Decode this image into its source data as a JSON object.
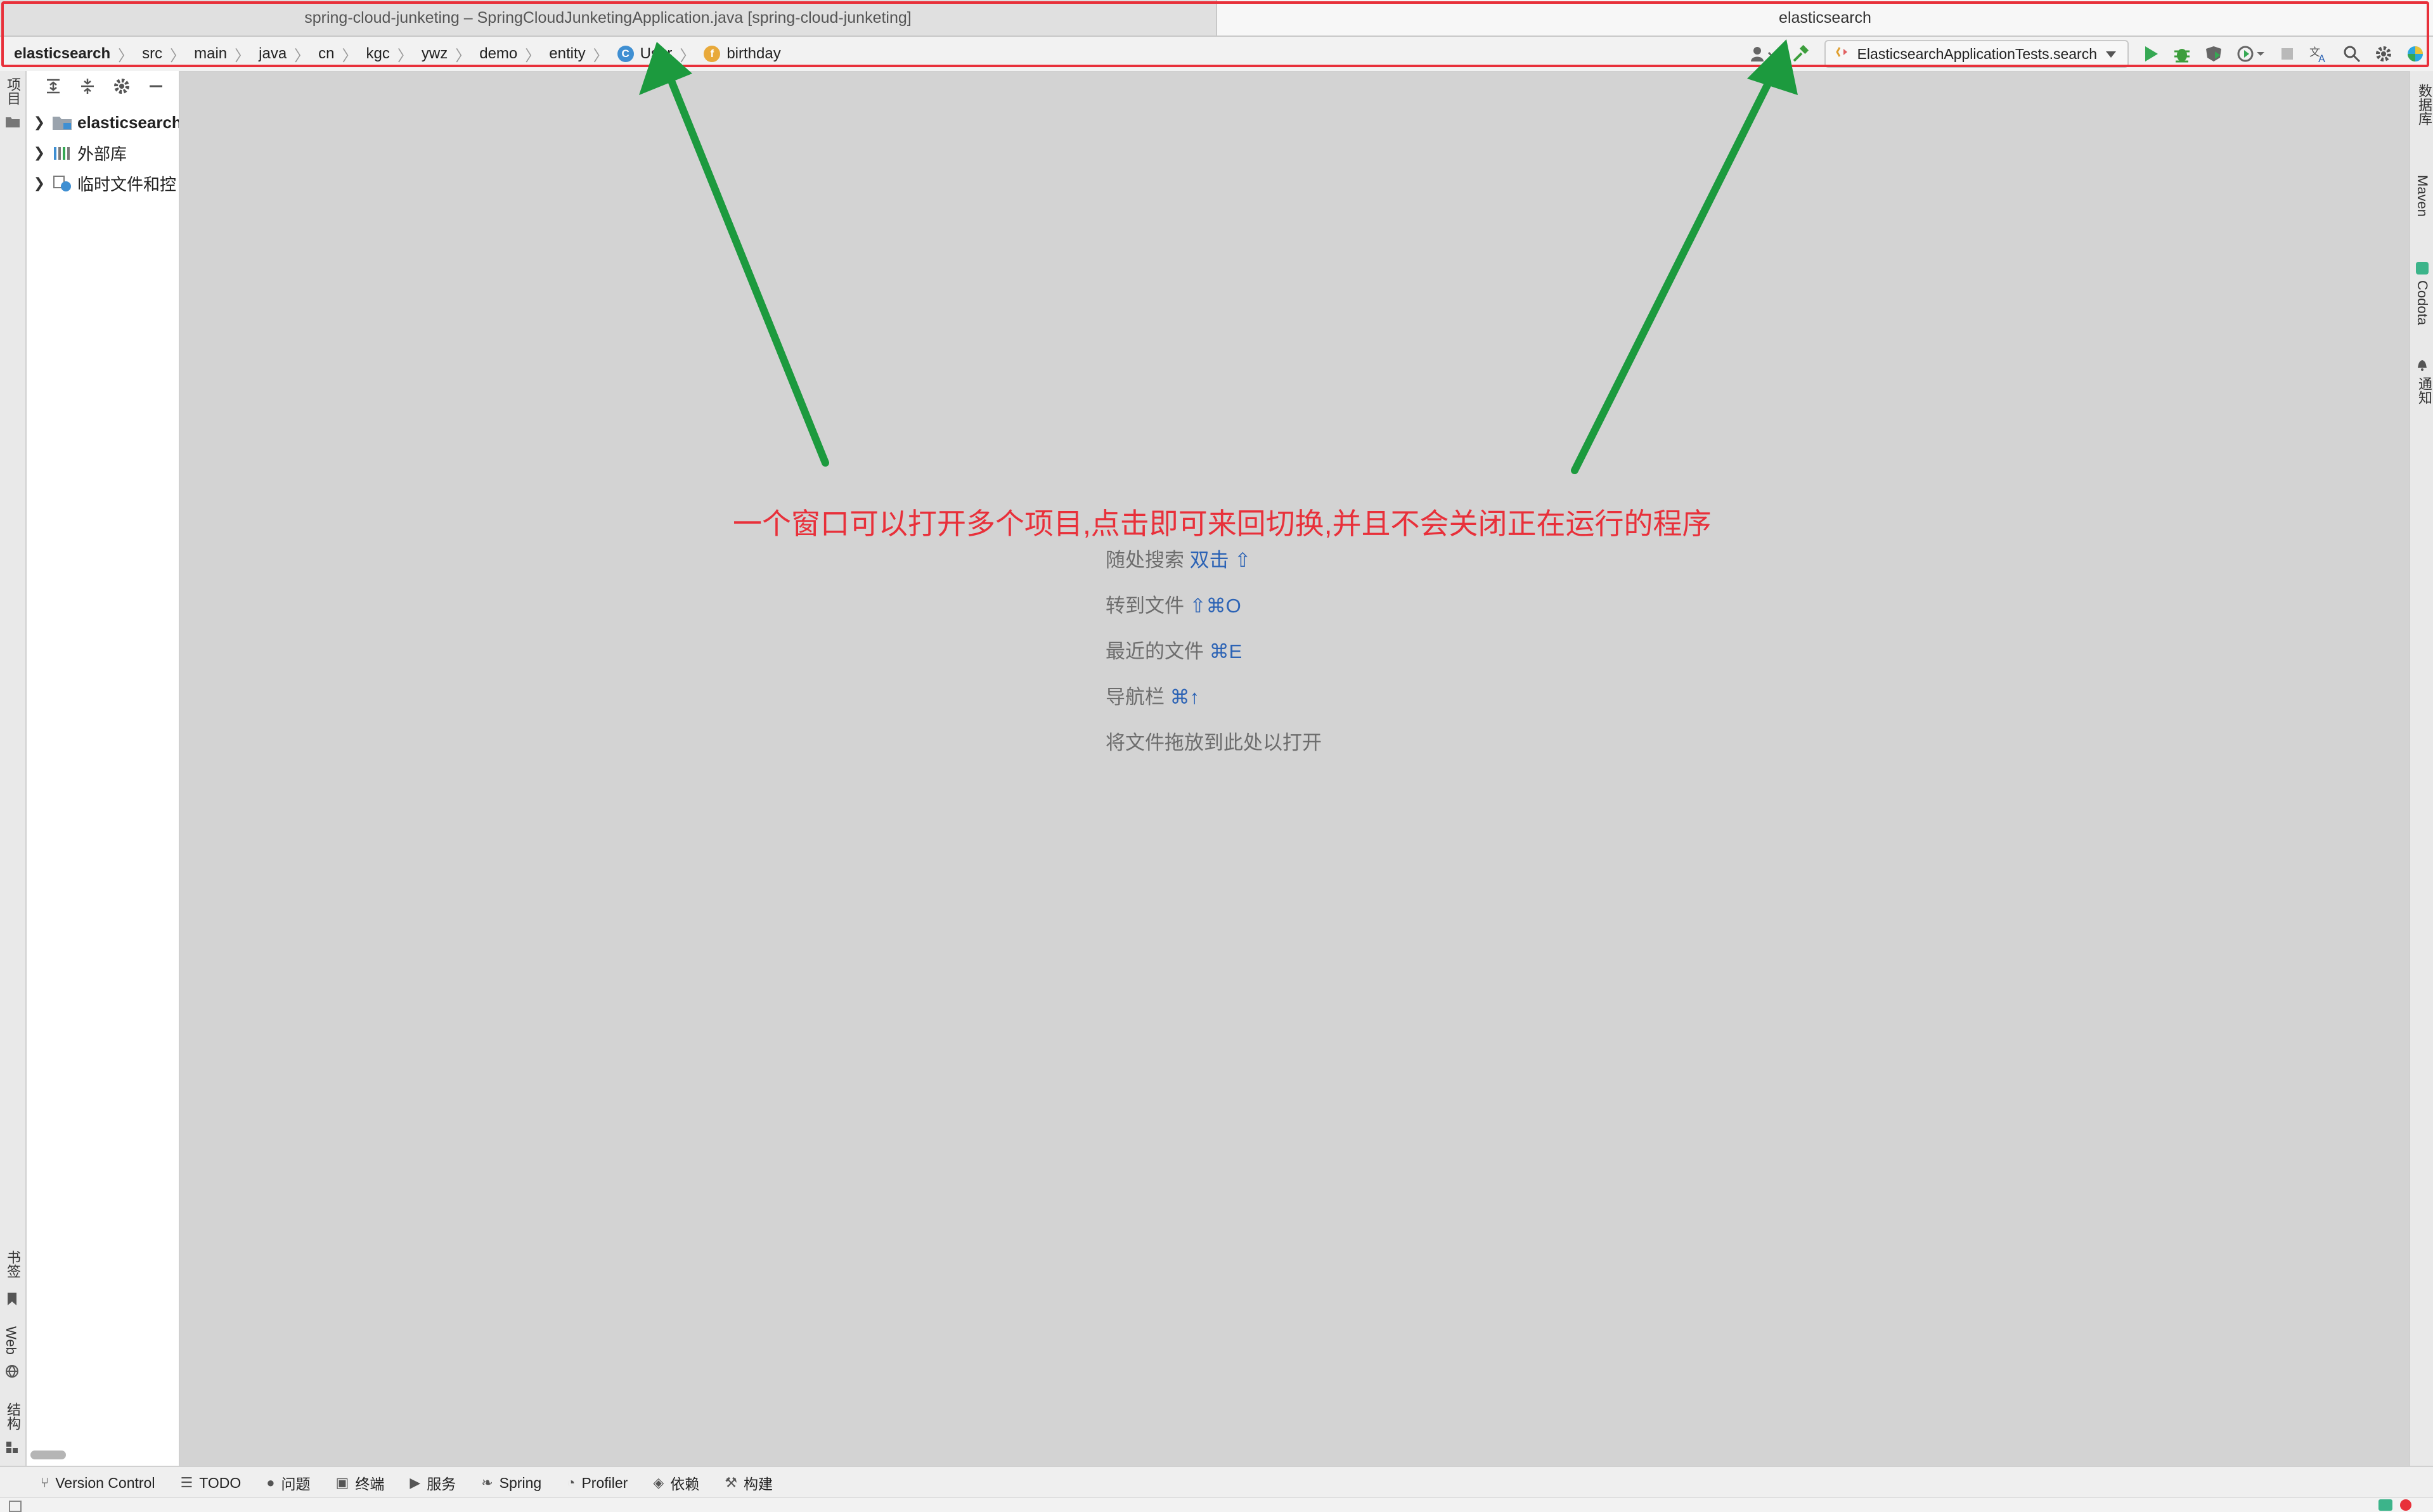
{
  "window_tabs": [
    {
      "label": "spring-cloud-junketing – SpringCloudJunketingApplication.java [spring-cloud-junketing]",
      "active": false
    },
    {
      "label": "elasticsearch",
      "active": true
    }
  ],
  "breadcrumb": {
    "root": "elasticsearch",
    "parts": [
      "src",
      "main",
      "java",
      "cn",
      "kgc",
      "ywz",
      "demo",
      "entity"
    ],
    "class_badge": "C",
    "class_name": "User",
    "field_badge": "f",
    "field_name": "birthday"
  },
  "toolbar": {
    "run_config": "ElasticsearchApplicationTests.search",
    "colors": {
      "run": "#35a853",
      "debug": "#3c9e3c",
      "annotation": "#e8303a",
      "arrow": "#1c9a3e"
    }
  },
  "left_stripe": {
    "top_label": "项目",
    "bottom_labels": [
      "书签",
      "Web",
      "结构"
    ]
  },
  "project_tree": [
    {
      "label": "elasticsearch",
      "bold": true,
      "icon": "folder-icon"
    },
    {
      "label": "外部库",
      "bold": false,
      "icon": "library-icon"
    },
    {
      "label": "临时文件和控",
      "bold": false,
      "icon": "scratch-icon"
    }
  ],
  "empty_editor": {
    "hints": [
      {
        "text": "随处搜索",
        "key": "双击 ⇧"
      },
      {
        "text": "转到文件",
        "key": "⇧⌘O"
      },
      {
        "text": "最近的文件",
        "key": "⌘E"
      },
      {
        "text": "导航栏",
        "key": "⌘↑"
      },
      {
        "text": "将文件拖放到此处以打开",
        "key": ""
      }
    ]
  },
  "annotation": "一个窗口可以打开多个项目,点击即可来回切换,并且不会关闭正在运行的程序",
  "right_stripe": [
    "数据库",
    "Maven",
    "Codota",
    "通知"
  ],
  "bottom_tabs": [
    {
      "label": "Version Control",
      "icon": "branch-icon"
    },
    {
      "label": "TODO",
      "icon": "list-icon"
    },
    {
      "label": "问题",
      "icon": "problems-icon"
    },
    {
      "label": "终端",
      "icon": "terminal-icon"
    },
    {
      "label": "服务",
      "icon": "services-icon"
    },
    {
      "label": "Spring",
      "icon": "spring-icon"
    },
    {
      "label": "Profiler",
      "icon": "profiler-icon"
    },
    {
      "label": "依赖",
      "icon": "dependencies-icon"
    },
    {
      "label": "构建",
      "icon": "build-icon"
    }
  ]
}
